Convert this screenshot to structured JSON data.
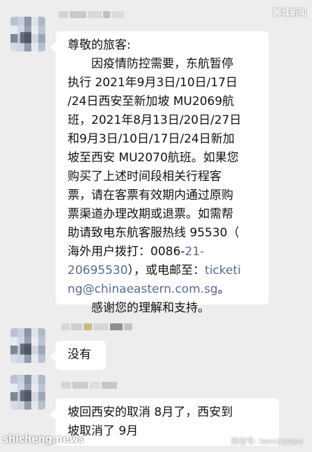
{
  "watermarks": {
    "top_right": "狮城新闻",
    "bottom_left": "shicheng.news",
    "bottom_right": "微信号: kanxinjiapo"
  },
  "messages": [
    {
      "lines": [
        {
          "text": "尊敬的旅客:"
        },
        {
          "text": "　　因疫情防控需要，东航暂停"
        },
        {
          "text": "执行 2021年9月3日/10日/17日"
        },
        {
          "text": "/24日西安至新加坡 MU2069航"
        },
        {
          "text": "班，2021年8月13日/20日/27日"
        },
        {
          "text": "和9月3日/10日/17日/24日新加"
        },
        {
          "text": "坡至西安 MU2070航班。如果您"
        },
        {
          "text": "购买了上述时间段相关行程客"
        },
        {
          "text": "票，请在客票有效期内通过原购"
        },
        {
          "text": "票渠道办理改期或退票。如需帮"
        },
        {
          "pre": "助请致电东航客服热线 95530（",
          "link": "",
          "post": ""
        },
        {
          "pre": "海外用户拨打：0086-",
          "link": "21-",
          "post": ""
        },
        {
          "pre": "",
          "link": "20695530",
          "post": "），或电邮至：",
          "link2": "ticketi"
        },
        {
          "pre": "",
          "link": "ng@chinaeastern.com.sg",
          "post": "。"
        },
        {
          "text": "　　感谢您的理解和支持。"
        }
      ]
    },
    {
      "lines": [
        {
          "text": "没有"
        }
      ]
    },
    {
      "lines": [
        {
          "text": "坡回西安的取消 8月了，西安到"
        },
        {
          "text": "坡取消了 9月"
        }
      ]
    }
  ],
  "colors": {
    "background": "#ededed",
    "bubble": "#ffffff",
    "link": "#576b95"
  }
}
